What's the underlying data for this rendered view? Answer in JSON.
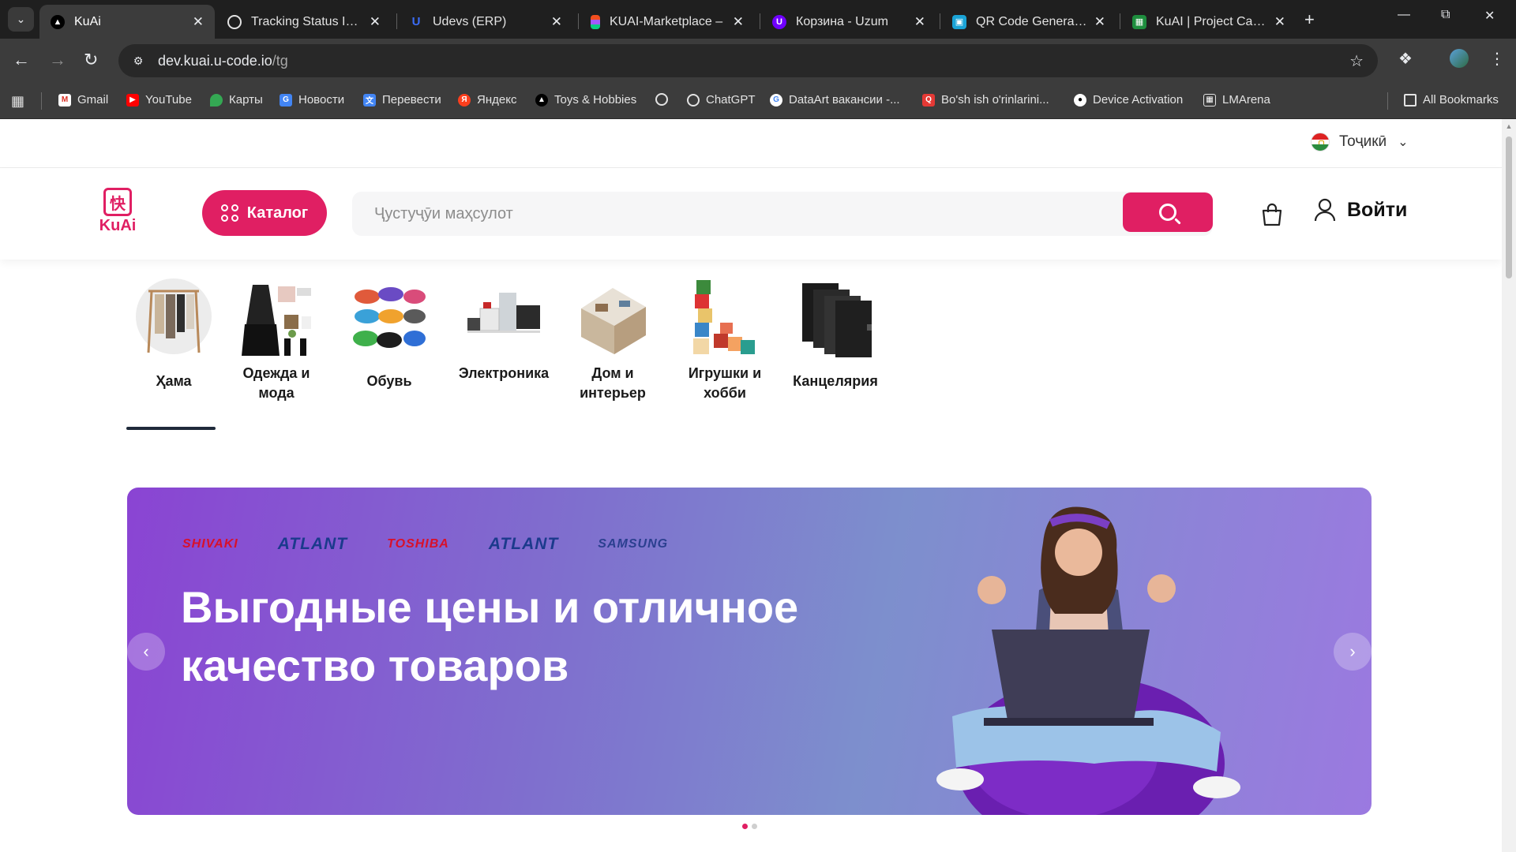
{
  "browser": {
    "tabs": [
      {
        "title": "KuAi",
        "active": true,
        "favicon": "kuai-favicon"
      },
      {
        "title": "Tracking Status Issue",
        "active": false,
        "favicon": "chatgpt-favicon"
      },
      {
        "title": "Udevs (ERP)",
        "active": false,
        "favicon": "udevs-favicon"
      },
      {
        "title": "KUAI-Marketplace – ",
        "active": false,
        "favicon": "figma-favicon"
      },
      {
        "title": "Корзина - Uzum",
        "active": false,
        "favicon": "uzum-favicon"
      },
      {
        "title": "QR Code Generator | ",
        "active": false,
        "favicon": "qr-favicon"
      },
      {
        "title": "KuAI | Project Card - ",
        "active": false,
        "favicon": "sheets-favicon"
      }
    ],
    "url_host": "dev.kuai.u-code.io",
    "url_path": "/tg",
    "bookmarks": [
      {
        "label": "Gmail",
        "icon": "gmail-icon"
      },
      {
        "label": "YouTube",
        "icon": "youtube-icon"
      },
      {
        "label": "Карты",
        "icon": "maps-icon"
      },
      {
        "label": "Новости",
        "icon": "news-icon"
      },
      {
        "label": "Перевести",
        "icon": "translate-icon"
      },
      {
        "label": "Яндекс",
        "icon": "yandex-icon"
      },
      {
        "label": "Toys & Hobbies",
        "icon": "triangle-icon"
      },
      {
        "label": "",
        "icon": "globe-icon"
      },
      {
        "label": "ChatGPT",
        "icon": "chatgpt-icon"
      },
      {
        "label": "DataArt вакансии -...",
        "icon": "google-icon"
      },
      {
        "label": "Bo'sh ish o'rinlarini...",
        "icon": "search-red-icon"
      },
      {
        "label": "Device Activation",
        "icon": "github-icon"
      },
      {
        "label": "LMArena",
        "icon": "lmarena-icon"
      }
    ],
    "all_bookmarks": "All Bookmarks"
  },
  "site": {
    "language": "Тоҷикӣ",
    "logo_text": "KuAi",
    "logo_glyph": "快",
    "catalog_label": "Каталог",
    "search_placeholder": "Ҷустуҷӯи маҳсулот",
    "login_label": "Войти",
    "categories": [
      {
        "label": "Ҳама",
        "active": true
      },
      {
        "label": "Одежда и мода",
        "active": false
      },
      {
        "label": "Обувь",
        "active": false
      },
      {
        "label": "Электроника",
        "active": false
      },
      {
        "label": "Дом и интерьер",
        "active": false
      },
      {
        "label": "Игрушки и хобби",
        "active": false
      },
      {
        "label": "Канцелярия",
        "active": false
      }
    ],
    "banner": {
      "brands": [
        "SHIVAKI",
        "ATLANT",
        "TOSHIBA",
        "ATLANT",
        "SAMSUNG"
      ],
      "title": "Выгодные цены и отличное качество товаров"
    },
    "carousel": {
      "slides": 2,
      "active_index": 0
    }
  },
  "colors": {
    "accent": "#e01f63",
    "banner_start": "#8a44d3",
    "banner_end": "#9b79e0"
  }
}
